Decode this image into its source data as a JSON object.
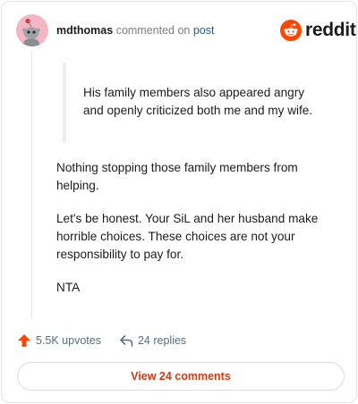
{
  "header": {
    "username": "mdthomas",
    "verb": "commented on",
    "post_link": "post",
    "brand": "reddit"
  },
  "comment": {
    "quote": "His family members also appeared angry and openly criticized both me and my wife.",
    "paragraphs": [
      "Nothing stopping those family members from helping.",
      "Let's be honest. Your SiL and her husband make horrible choices. These choices are not your responsibility to pay for.",
      "NTA"
    ]
  },
  "footer": {
    "upvotes": "5.5K upvotes",
    "replies": "24 replies",
    "view_button": "View 24 comments"
  },
  "colors": {
    "brand_orange": "#ff4500",
    "upvote_orange": "#ff4500",
    "link_blue": "#1c5fa6",
    "button_text": "#d13b12"
  },
  "icons": {
    "avatar": "snoo-avatar-icon",
    "logo": "reddit-snoo-icon",
    "upvote": "upvote-arrow-icon",
    "reply": "reply-arrow-icon"
  }
}
